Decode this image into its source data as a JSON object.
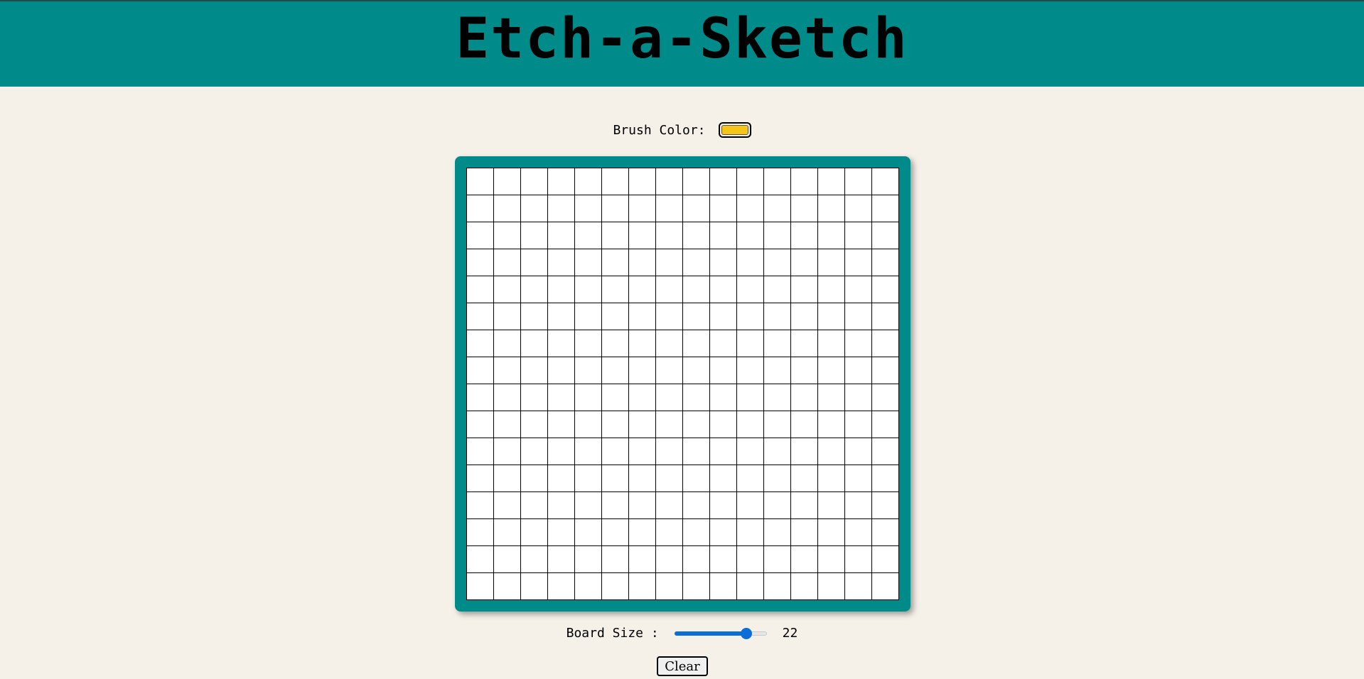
{
  "header": {
    "title": "Etch-a-Sketch",
    "background_color": "#008b8b"
  },
  "brush": {
    "label": "Brush Color:",
    "color": "#f5c518"
  },
  "board": {
    "frame_color": "#008b8b",
    "grid_columns": 16,
    "grid_rows": 16,
    "cell_color": "#ffffff"
  },
  "board_size": {
    "label": "Board Size :",
    "value": "22",
    "slider_fraction": 0.78
  },
  "actions": {
    "clear_label": "Clear"
  }
}
